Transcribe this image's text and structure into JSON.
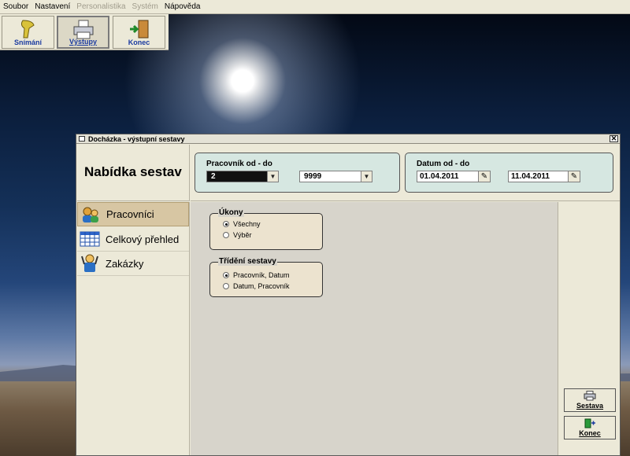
{
  "menubar": {
    "items": [
      {
        "label": "Soubor",
        "enabled": true
      },
      {
        "label": "Nastavení",
        "enabled": true
      },
      {
        "label": "Personalistika",
        "enabled": false
      },
      {
        "label": "Systém",
        "enabled": false
      },
      {
        "label": "Nápověda",
        "enabled": true
      }
    ]
  },
  "toolbar": {
    "buttons": [
      {
        "label": "Snímání",
        "icon": "barcode-scanner-icon"
      },
      {
        "label": "Výstupy",
        "icon": "printer-icon",
        "active": true
      },
      {
        "label": "Konec",
        "icon": "exit-door-icon"
      }
    ]
  },
  "window": {
    "title": "Docházka - výstupní sestavy",
    "close_glyph": "✕"
  },
  "header": {
    "page_title": "Nabídka sestav",
    "worker_group": {
      "title": "Pracovník od - do",
      "from_value": "2",
      "to_value": "9999"
    },
    "date_group": {
      "title": "Datum od - do",
      "from_value": "01.04.2011",
      "to_value": "11.04.2011"
    }
  },
  "nav": {
    "items": [
      {
        "label": "Pracovníci",
        "icon": "workers-icon",
        "selected": true
      },
      {
        "label": "Celkový přehled",
        "icon": "table-overview-icon",
        "selected": false
      },
      {
        "label": "Zakázky",
        "icon": "orders-worker-icon",
        "selected": false
      }
    ]
  },
  "content": {
    "ukony": {
      "title": "Úkony",
      "options": [
        {
          "label": "Všechny",
          "checked": true
        },
        {
          "label": "Výběr",
          "checked": false
        }
      ]
    },
    "trideni": {
      "title": "Třídění sestavy",
      "options": [
        {
          "label": "Pracovník, Datum",
          "checked": true
        },
        {
          "label": "Datum, Pracovník",
          "checked": false
        }
      ]
    }
  },
  "actions": {
    "report_label": "Sestava",
    "exit_label": "Konec"
  },
  "colors": {
    "accent_blue": "#1a3aa0",
    "group_bg": "#d6e7e1",
    "selected_nav": "#d7c6a3"
  }
}
